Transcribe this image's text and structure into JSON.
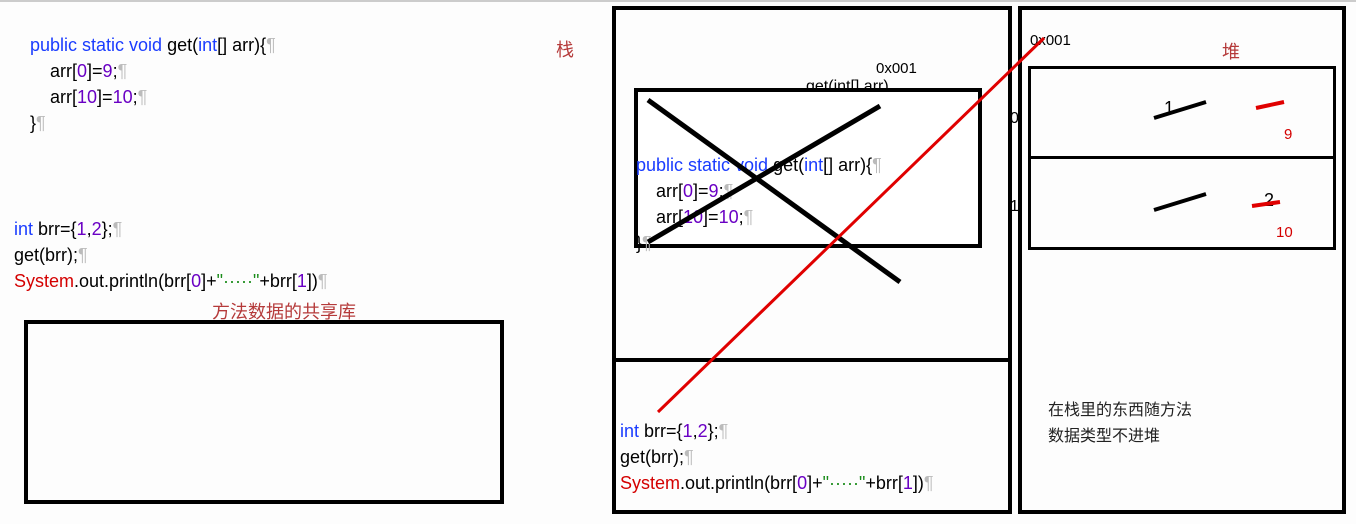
{
  "labels": {
    "stack": "栈",
    "heap": "堆",
    "shared": "方法数据的共享库",
    "addr": "0x001",
    "getcall": "get(int[] arr)",
    "idx0": "0",
    "idx1": "1",
    "val1": "1",
    "val2": "2",
    "val9": "9",
    "val10": "10",
    "note_line1": "在栈里的东西随方法",
    "note_line2": "数据类型不进堆"
  },
  "code": {
    "ps": "public static void",
    "get": " get(",
    "int": "int",
    "arr_param": "[] arr){",
    "assign1a": "    arr[",
    "zero": "0",
    "assign1b": "]=",
    "nine": "9",
    "semi": ";",
    "assign2a": "    arr[",
    "ten_idx": "10",
    "assign2b": "]=",
    "ten_val": "10",
    "close": "}",
    "brr_decl_a": " brr={",
    "one": "1",
    "comma": ",",
    "two": "2",
    "brr_decl_b": "};",
    "getbrr": "get(brr);",
    "system": "System",
    "println_a": ".out.println(brr[",
    "println_b": "]+",
    "dots_str": "\"·····\"",
    "println_c": "+brr[",
    "println_d": "])",
    "pilcrow": "¶"
  }
}
